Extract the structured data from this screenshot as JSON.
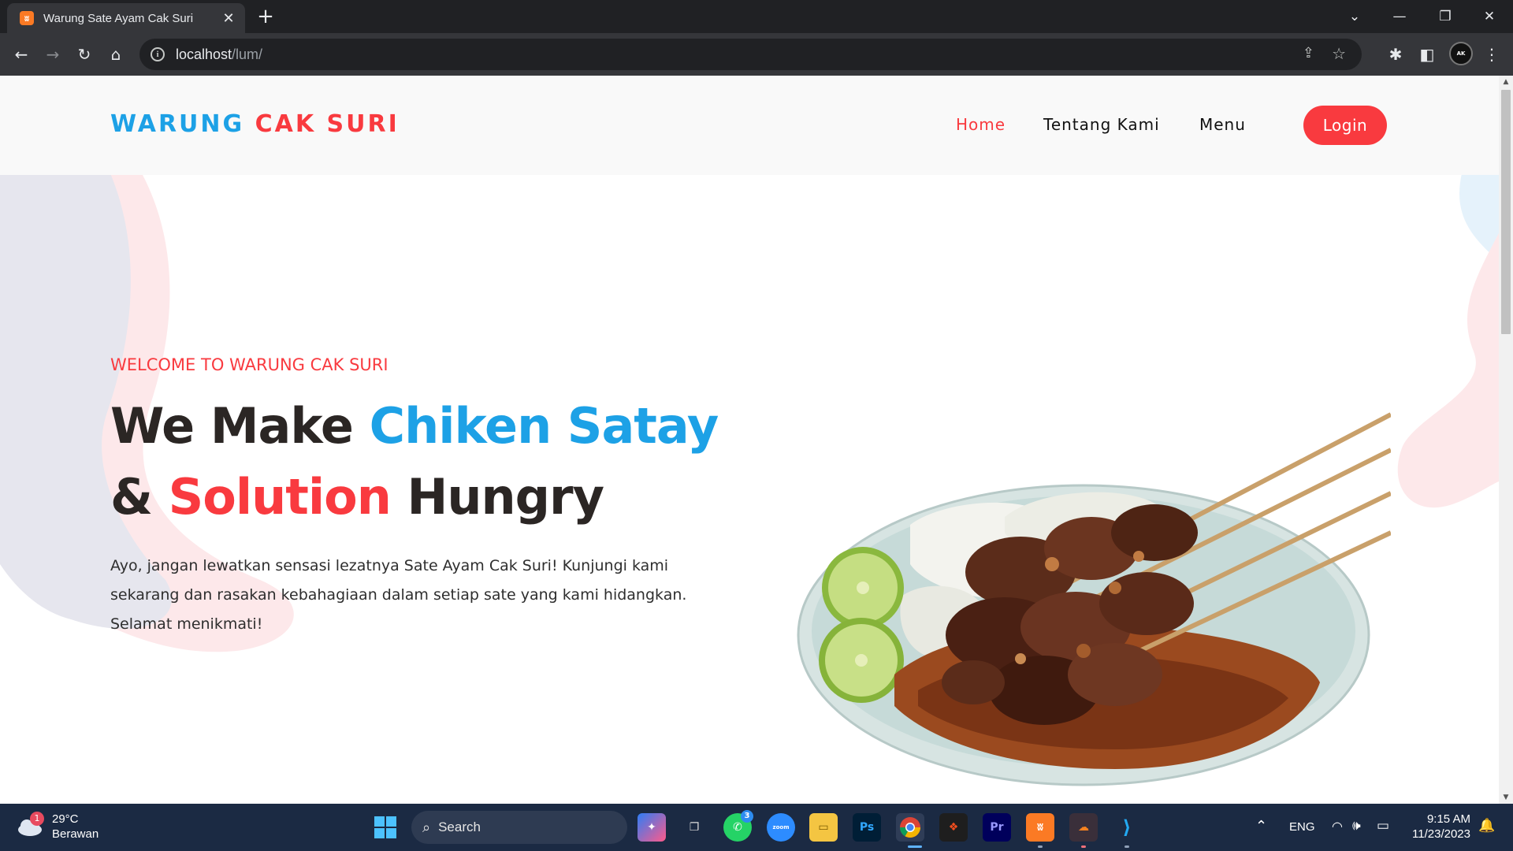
{
  "browser": {
    "tab_title": "Warung Sate Ayam Cak Suri",
    "url_host": "localhost",
    "url_path": "/lum/"
  },
  "nav": {
    "logo_part1": "WARUNG",
    "logo_part2": "CAK SURI",
    "links": [
      "Home",
      "Tentang Kami",
      "Menu"
    ],
    "login_label": "Login"
  },
  "hero": {
    "eyebrow": "WELCOME TO WARUNG CAK SURI",
    "line1_dark": "We Make ",
    "line1_blue": "Chiken Satay",
    "line2_amp": "& ",
    "line2_red": "Solution",
    "line2_dark": " Hungry",
    "description": "Ayo, jangan lewatkan sensasi lezatnya Sate Ayam Cak Suri! Kunjungi kami sekarang dan rasakan kebahagiaan dalam setiap sate yang kami hidangkan. Selamat menikmati!"
  },
  "taskbar": {
    "weather_temp": "29°C",
    "weather_desc": "Berawan",
    "weather_badge": "1",
    "search_label": "Search",
    "whatsapp_badge": "3",
    "language": "ENG",
    "time": "9:15 AM",
    "date": "11/23/2023"
  },
  "colors": {
    "accent_red": "#f93a3f",
    "accent_blue": "#1da1e6",
    "chrome_dark": "#202124",
    "taskbar": "#1b2a43"
  }
}
